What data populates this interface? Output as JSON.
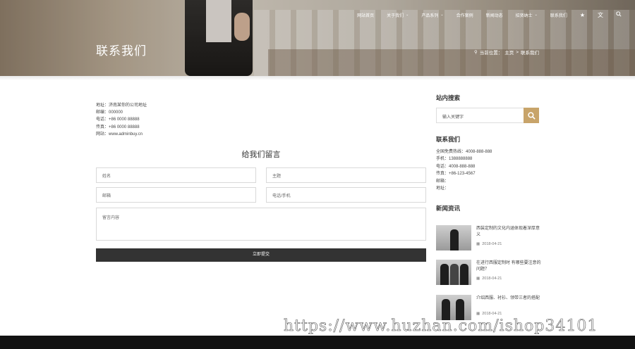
{
  "nav": {
    "items": [
      {
        "label": "网站首页",
        "dropdown": false
      },
      {
        "label": "关于我们",
        "dropdown": true
      },
      {
        "label": "产品系列",
        "dropdown": true
      },
      {
        "label": "合作案例",
        "dropdown": false
      },
      {
        "label": "新闻动态",
        "dropdown": false
      },
      {
        "label": "招贤纳士",
        "dropdown": true
      },
      {
        "label": "联系我们",
        "dropdown": false
      }
    ],
    "extra_icons": [
      "star-icon",
      "language-icon",
      "search-icon"
    ]
  },
  "header": {
    "page_title": "联系我们",
    "breadcrumb": {
      "prefix": "当前位置：",
      "home": "主页",
      "sep": ">",
      "current": "联系我们"
    }
  },
  "contact": {
    "lines": [
      "地址：济南某你的公司地址",
      "邮编：000000",
      "电话：+86 0000 88888",
      "传真：+86 0000 88888",
      "网站：www.adminbuy.cn"
    ]
  },
  "form": {
    "title": "给我们留言",
    "name_placeholder": "姓名",
    "subject_placeholder": "主题",
    "email_placeholder": "邮箱",
    "phone_placeholder": "电话/手机",
    "message_placeholder": "留言内容",
    "submit_label": "立即提交"
  },
  "sidebar": {
    "search_title": "站内搜索",
    "search_placeholder": "输入关键字",
    "contact_title": "联系我们",
    "contact_lines": [
      "全国免费热线：4008-888-888",
      "手机：1388888888",
      "电话：4008-888-888",
      "传真：+86-123-4567",
      "邮箱：",
      "地址："
    ],
    "news_title": "新闻资讯",
    "news": [
      {
        "title": "西装定制的文化内涵体现着深厚意义",
        "date": "2018-04-21"
      },
      {
        "title": "在进行西服定制时 有哪些要注意的问题？",
        "date": "2018-04-21"
      },
      {
        "title": "介绍西服、衬衫、领带三者的搭配",
        "date": "2018-04-21"
      }
    ]
  },
  "watermark": "https://www.huzhan.com/ishop34101"
}
